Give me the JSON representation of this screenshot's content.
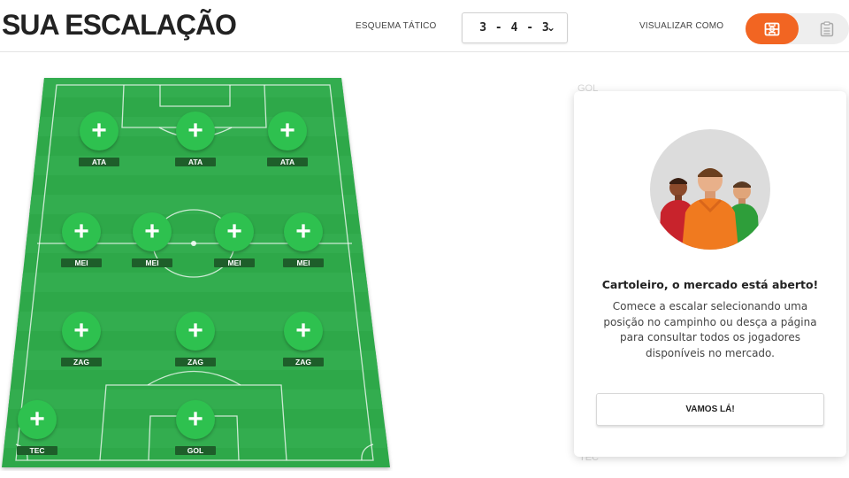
{
  "header": {
    "title": "SUA ESCALAÇÃO",
    "formation_label": "ESQUEMA TÁTICO",
    "formation_value": "3-4-3",
    "view_label": "VISUALIZAR COMO",
    "view_options": [
      "field-icon",
      "list-icon"
    ],
    "active_view": "field"
  },
  "colors": {
    "accent": "#f26522",
    "field_green": "#2ea84a",
    "add_button": "#2ec14f",
    "position_tag": "#1e5e2a"
  },
  "field": {
    "add_icon": "+",
    "slots": [
      {
        "pos": "ATA"
      },
      {
        "pos": "ATA"
      },
      {
        "pos": "ATA"
      },
      {
        "pos": "MEI"
      },
      {
        "pos": "MEI"
      },
      {
        "pos": "MEI"
      },
      {
        "pos": "MEI"
      },
      {
        "pos": "ZAG"
      },
      {
        "pos": "ZAG"
      },
      {
        "pos": "ZAG"
      },
      {
        "pos": "TEC"
      },
      {
        "pos": "GOL"
      }
    ]
  },
  "background_list": {
    "first_label": "GOL",
    "last_label": "TEC"
  },
  "market_card": {
    "title": "Cartoleiro, o mercado está aberto!",
    "text": "Comece a escalar selecionando uma posição no campinho ou desça a página para consultar todos os jogadores disponíveis no mercado.",
    "button_label": "VAMOS LÁ!"
  }
}
